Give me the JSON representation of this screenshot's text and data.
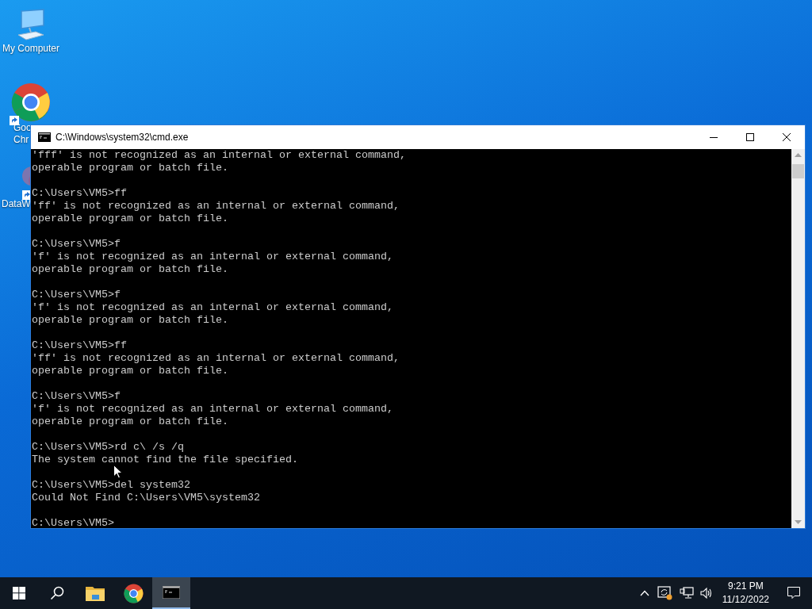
{
  "desktop_icons": [
    {
      "kind": "computer",
      "label_lines": [
        "My Computer"
      ]
    },
    {
      "kind": "chrome",
      "label_lines": [
        "Goo",
        "Chr"
      ]
    },
    {
      "kind": "app",
      "label_lines": [
        "DataW"
      ]
    }
  ],
  "window": {
    "title": "C:\\Windows\\system32\\cmd.exe",
    "blocks": [
      [
        "'fff' is not recognized as an internal or external command,",
        "operable program or batch file."
      ],
      [
        "C:\\Users\\VM5>ff",
        "'ff' is not recognized as an internal or external command,",
        "operable program or batch file."
      ],
      [
        "C:\\Users\\VM5>f",
        "'f' is not recognized as an internal or external command,",
        "operable program or batch file."
      ],
      [
        "C:\\Users\\VM5>f",
        "'f' is not recognized as an internal or external command,",
        "operable program or batch file."
      ],
      [
        "C:\\Users\\VM5>ff",
        "'ff' is not recognized as an internal or external command,",
        "operable program or batch file."
      ],
      [
        "C:\\Users\\VM5>f",
        "'f' is not recognized as an internal or external command,",
        "operable program or batch file."
      ],
      [
        "C:\\Users\\VM5>rd c\\ /s /q",
        "The system cannot find the file specified."
      ],
      [
        "C:\\Users\\VM5>del system32",
        "Could Not Find C:\\Users\\VM5\\system32"
      ],
      [
        "C:\\Users\\VM5>"
      ]
    ]
  },
  "taskbar": {
    "apps": [
      {
        "kind": "start",
        "selected": false
      },
      {
        "kind": "search",
        "selected": false
      },
      {
        "kind": "folder",
        "selected": false
      },
      {
        "kind": "chrome",
        "selected": false
      },
      {
        "kind": "console",
        "selected": true
      }
    ],
    "time": "9:21 PM",
    "date": "11/12/2022"
  }
}
